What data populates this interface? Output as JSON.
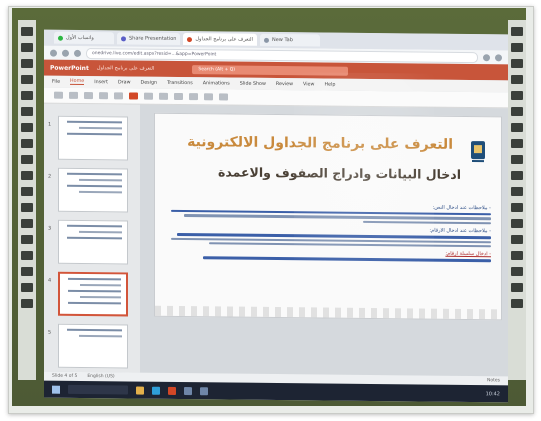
{
  "browser": {
    "tabs": [
      {
        "label": "واتساب الأول"
      },
      {
        "label": "Share Presentation"
      },
      {
        "label": "التعرف على برنامج الجداول"
      },
      {
        "label": "New Tab"
      }
    ],
    "url": "onedrive.live.com/edit.aspx?resid=...&app=PowerPoint"
  },
  "app": {
    "name": "PowerPoint",
    "document": "التعرف على برنامج الجداول",
    "search_placeholder": "Search (Alt + Q)"
  },
  "ribbon": {
    "tabs": [
      "File",
      "Home",
      "Insert",
      "Draw",
      "Design",
      "Transitions",
      "Animations",
      "Slide Show",
      "Review",
      "View",
      "Help"
    ],
    "active_tab": "Home"
  },
  "thumbnails": [
    {
      "num": "1"
    },
    {
      "num": "2"
    },
    {
      "num": "3"
    },
    {
      "num": "4"
    },
    {
      "num": "5"
    }
  ],
  "slide": {
    "title": "التعرف على برنامج الجداول الالكترونية",
    "subtitle": "ادخال البيانات وادراج الصفوف والاعمدة",
    "sections": [
      {
        "heading": "- ملاحظات عند ادخال النص:"
      },
      {
        "heading": "- ملاحظات عند ادخال الارقام:"
      },
      {
        "heading": "- ادخال سلسلة ارقام:"
      }
    ]
  },
  "status": {
    "slide_info": "Slide 4 of 5",
    "language": "English (US)",
    "notes": "Notes"
  },
  "taskbar": {
    "clock": "10:42"
  },
  "colors": {
    "ppt_accent": "#c8553a",
    "title_gold": "#c98a3d",
    "taskbar": "#1d2433"
  }
}
